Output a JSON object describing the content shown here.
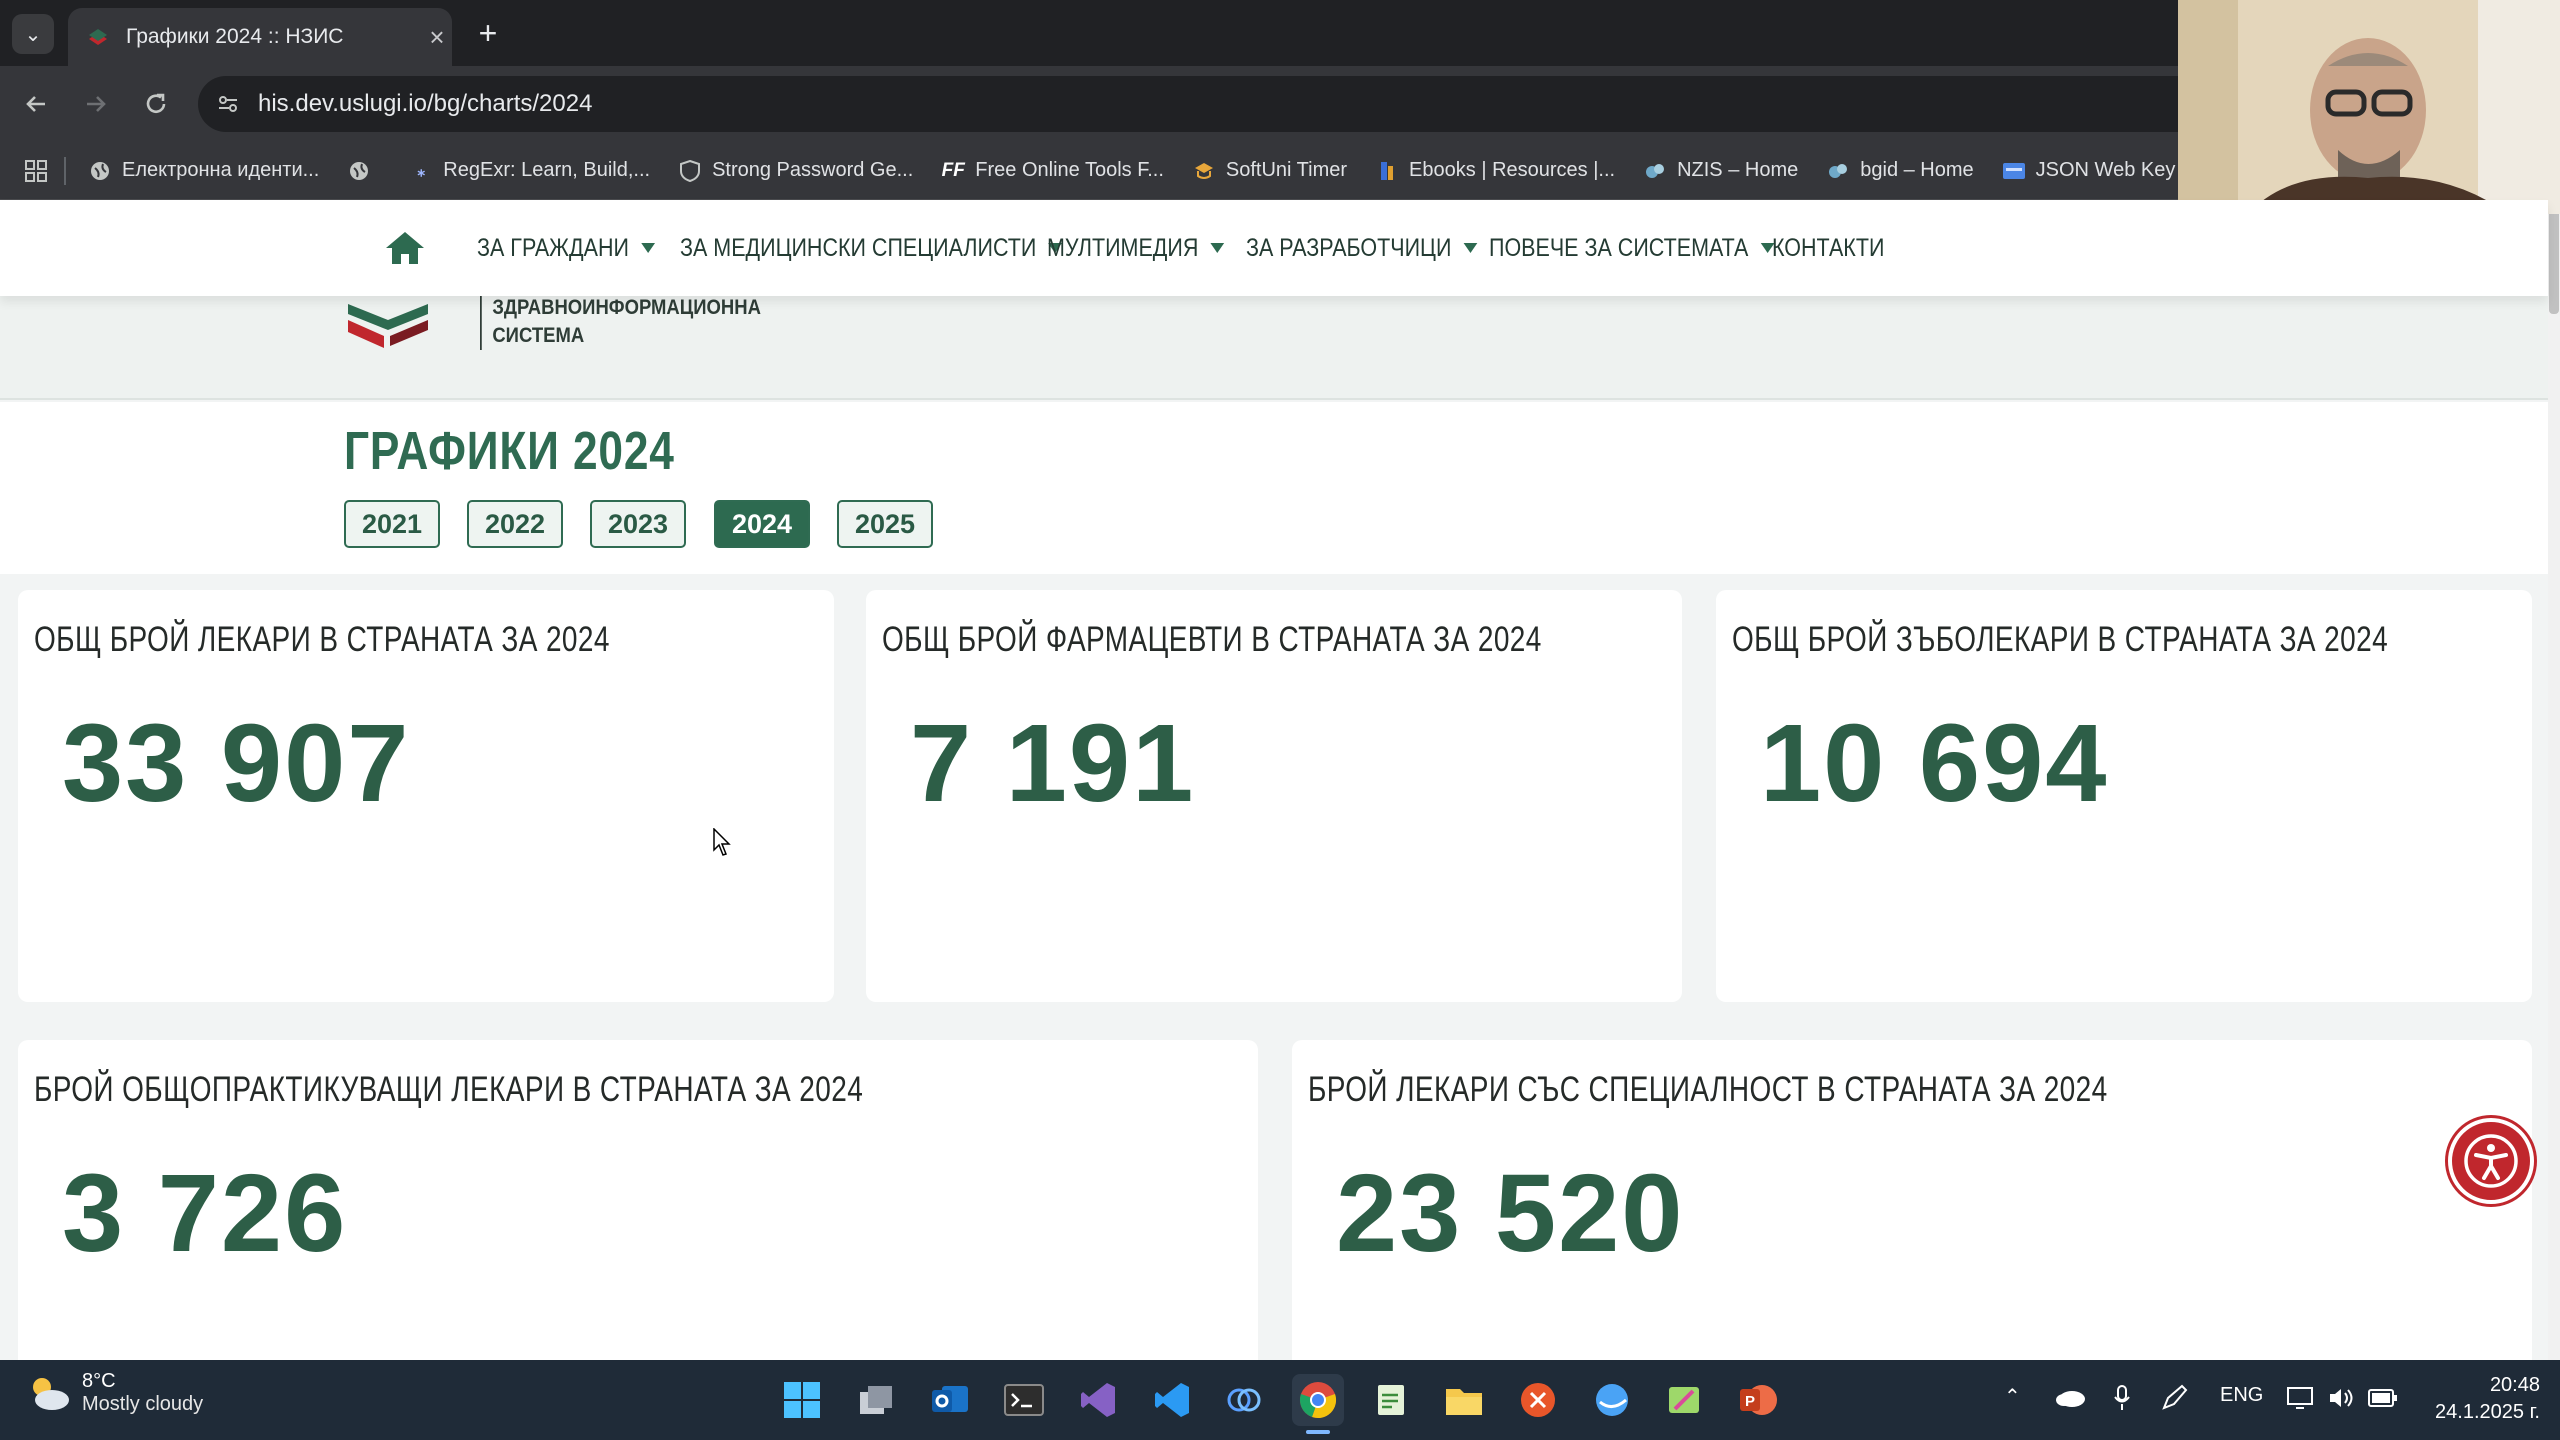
{
  "browser": {
    "tab_title": "Графики 2024 :: НЗИС",
    "new_tab": "+",
    "url": "his.dev.uslugi.io/bg/charts/2024",
    "bookmarks": [
      {
        "label": "Електронна иденти...",
        "icon": "globe-icon"
      },
      {
        "label": "",
        "icon": "globe-icon"
      },
      {
        "label": "RegExr: Learn, Build,...",
        "icon": "regexr-icon"
      },
      {
        "label": "Strong Password Ge...",
        "icon": "shield-icon"
      },
      {
        "label": "Free Online Tools F...",
        "icon": "ff-icon",
        "icon_text": "FF"
      },
      {
        "label": "SoftUni Timer",
        "icon": "softuni-icon"
      },
      {
        "label": "Ebooks | Resources |...",
        "icon": "ebooks-icon"
      },
      {
        "label": "NZIS – Home",
        "icon": "nzis-icon"
      },
      {
        "label": "bgid – Home",
        "icon": "bgid-icon"
      },
      {
        "label": "JSON Web Key (JV",
        "icon": "jwk-icon"
      }
    ]
  },
  "site": {
    "nav": [
      {
        "label": "ЗА ГРАЖДАНИ",
        "dropdown": true
      },
      {
        "label": "ЗА МЕДИЦИНСКИ СПЕЦИАЛИСТИ",
        "dropdown": true
      },
      {
        "label": "МУЛТИМЕДИЯ",
        "dropdown": true
      },
      {
        "label": "ЗА РАЗРАБОТЧИЦИ",
        "dropdown": true
      },
      {
        "label": "ПОВЕЧЕ ЗА СИСТЕМАТА",
        "dropdown": true
      },
      {
        "label": "КОНТАКТИ",
        "dropdown": false
      }
    ],
    "logo_line1": "ЗДРАВНОИНФОРМАЦИОННА",
    "logo_line2": "СИСТЕМА",
    "page_title": "ГРАФИКИ 2024",
    "years": [
      "2021",
      "2022",
      "2023",
      "2024",
      "2025"
    ],
    "active_year": "2024",
    "cards": [
      {
        "title": "ОБЩ БРОЙ ЛЕКАРИ В СТРАНАТА ЗА 2024",
        "value": "33 907"
      },
      {
        "title": "ОБЩ БРОЙ ФАРМАЦЕВТИ В СТРАНАТА ЗА 2024",
        "value": "7 191"
      },
      {
        "title": "ОБЩ БРОЙ ЗЪБОЛЕКАРИ В СТРАНАТА ЗА 2024",
        "value": "10 694"
      },
      {
        "title": "БРОЙ ОБЩОПРАКТИКУВАЩИ ЛЕКАРИ В СТРАНАТА ЗА 2024",
        "value": "3 726"
      },
      {
        "title": "БРОЙ ЛЕКАРИ СЪС СПЕЦИАЛНОСТ В СТРАНАТА ЗА 2024",
        "value": "23 520"
      }
    ]
  },
  "taskbar": {
    "weather_temp": "8°C",
    "weather_desc": "Mostly cloudy",
    "language": "ENG",
    "time": "20:48",
    "date": "24.1.2025 г."
  },
  "colors": {
    "brand_green": "#2d6a50",
    "value_green": "#2d5e47",
    "accessibility_red": "#c0272d"
  }
}
